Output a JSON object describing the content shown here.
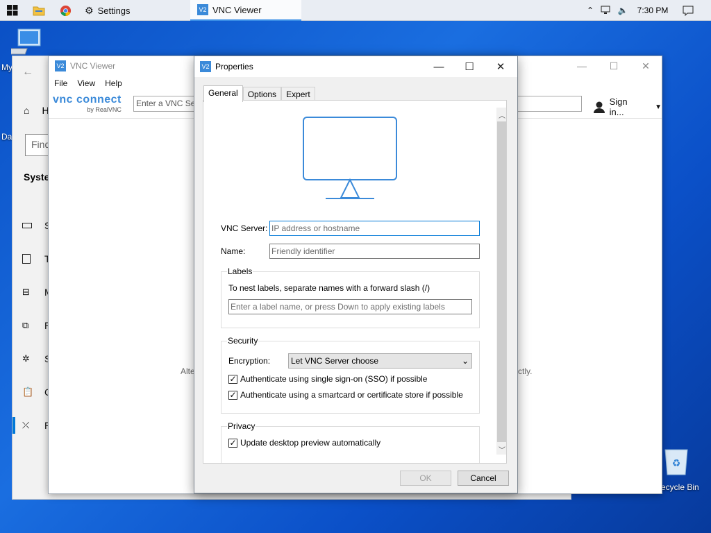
{
  "taskbar": {
    "settings_label": "Settings",
    "vnc_label": "VNC Viewer",
    "clock": "7:30 PM"
  },
  "desktop": {
    "my_computer_label": "My",
    "data_label": "Da",
    "recycle_bin_label": "ecycle Bin"
  },
  "settings_window": {
    "home_letter": "H",
    "find_placeholder": "Find",
    "system_label": "System",
    "nav_letters": [
      "S",
      "T",
      "M",
      "P",
      "S",
      "C",
      "R"
    ]
  },
  "vnc_viewer": {
    "title": "VNC Viewer",
    "menu": [
      "File",
      "View",
      "Help"
    ],
    "brand": "vnc connect",
    "brand_sub": "by RealVNC",
    "search_placeholder": "Enter a VNC Serv",
    "sign_in": "Sign in...",
    "body_left": "Alte",
    "body_right": "ctly."
  },
  "properties": {
    "title": "Properties",
    "tabs": [
      "General",
      "Options",
      "Expert"
    ],
    "active_tab": "General",
    "vnc_server_label": "VNC Server:",
    "vnc_server_placeholder": "IP address or hostname",
    "name_label": "Name:",
    "name_placeholder": "Friendly identifier",
    "labels": {
      "title": "Labels",
      "hint": "To nest labels, separate names with a forward slash (/)",
      "input_placeholder": "Enter a label name, or press Down to apply existing labels"
    },
    "security": {
      "title": "Security",
      "encryption_label": "Encryption:",
      "encryption_value": "Let VNC Server choose",
      "sso_label": "Authenticate using single sign-on (SSO) if possible",
      "sso_checked": true,
      "smartcard_label": "Authenticate using a smartcard or certificate store if possible",
      "smartcard_checked": true
    },
    "privacy": {
      "title": "Privacy",
      "preview_label": "Update desktop preview automatically",
      "preview_checked": true
    },
    "ok": "OK",
    "cancel": "Cancel"
  },
  "colors": {
    "accent": "#0078d7",
    "monitor_stroke": "#3b8ad9",
    "desktop_bg": "#1a6ee0"
  }
}
